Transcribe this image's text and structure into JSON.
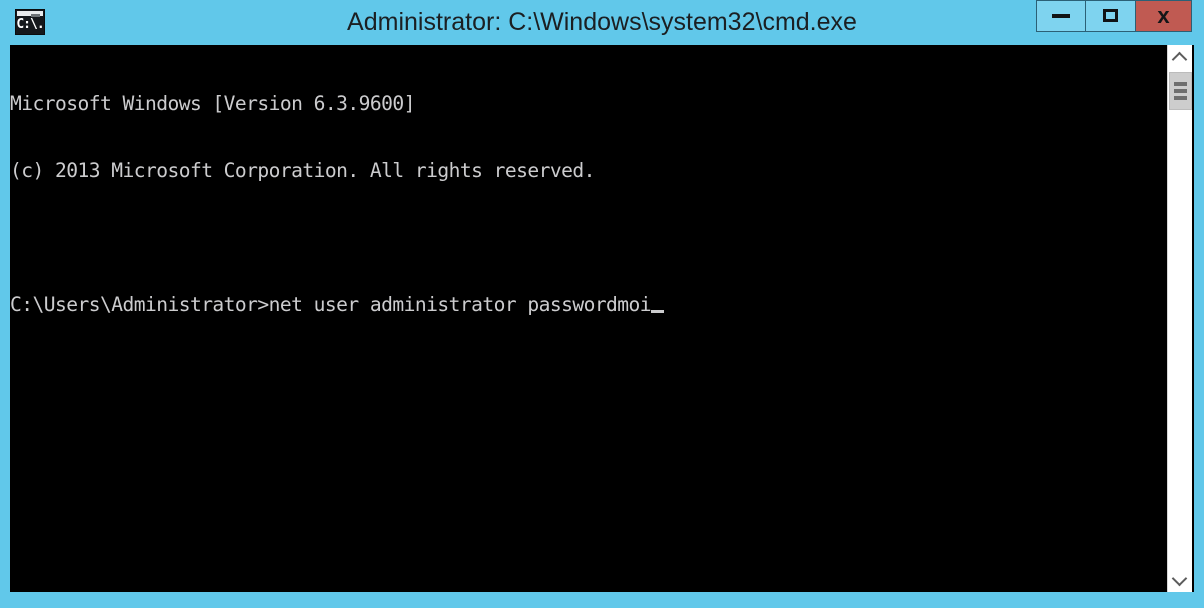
{
  "window": {
    "title": "Administrator: C:\\Windows\\system32\\cmd.exe",
    "icon_label": "C:\\.",
    "titlebar_color": "#61c8ea",
    "console_bg": "#000000",
    "console_fg": "#cccccc"
  },
  "controls": {
    "minimize_label": "",
    "maximize_label": "",
    "close_label": "x"
  },
  "console": {
    "lines": [
      "Microsoft Windows [Version 6.3.9600]",
      "(c) 2013 Microsoft Corporation. All rights reserved.",
      "",
      "C:\\Users\\Administrator>net user administrator passwordmoi"
    ],
    "prompt": "C:\\Users\\Administrator>",
    "command": "net user administrator passwordmoi",
    "cursor_visible": true
  },
  "scrollbar": {
    "up_arrow": "",
    "down_arrow": "",
    "thumb_position_percent": 0
  }
}
